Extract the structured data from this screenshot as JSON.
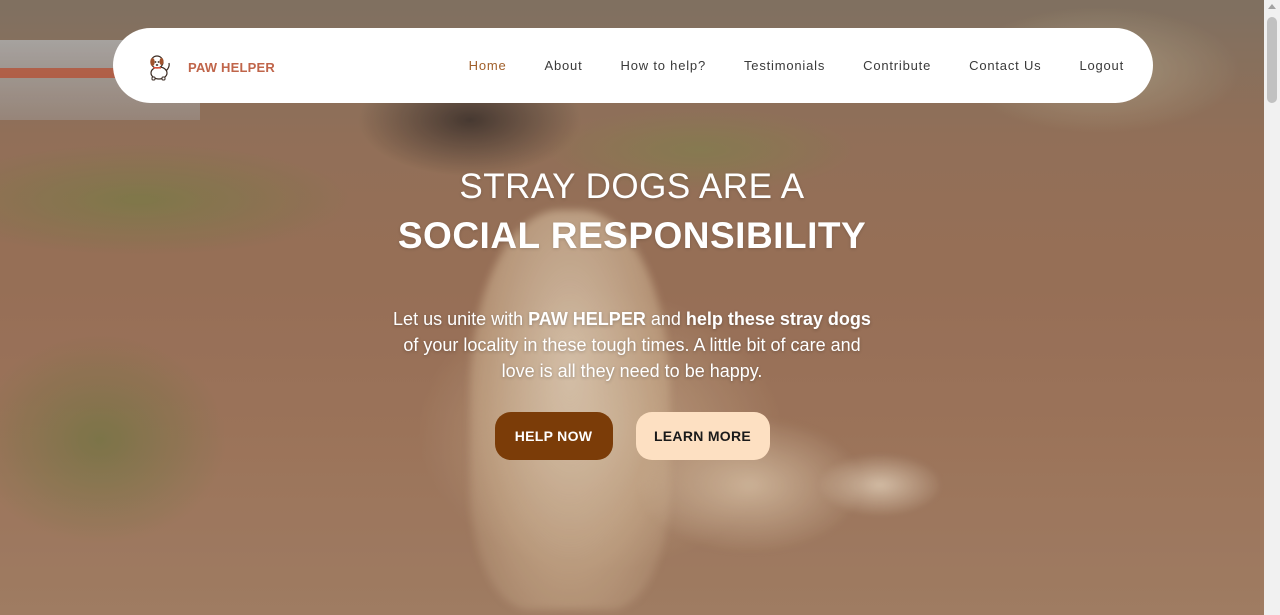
{
  "brand": {
    "name": "PAW HELPER",
    "logo_icon": "dog-logo-icon",
    "color": "#c0654a"
  },
  "nav": {
    "items": [
      {
        "label": "Home",
        "active": true
      },
      {
        "label": "About"
      },
      {
        "label": "How to help?"
      },
      {
        "label": "Testimonials"
      },
      {
        "label": "Contribute"
      },
      {
        "label": "Contact Us"
      },
      {
        "label": "Logout"
      }
    ],
    "active_color": "#a05f2a"
  },
  "hero": {
    "headline_line1": "STRAY DOGS ARE A",
    "headline_line2": "SOCIAL RESPONSIBILITY",
    "tagline_parts": [
      {
        "text": "Let us unite with ",
        "bold": false
      },
      {
        "text": "PAW HELPER",
        "bold": true
      },
      {
        "text": " and ",
        "bold": false
      },
      {
        "text": "help these stray dogs",
        "bold": true
      },
      {
        "text": " of your locality in these tough times. A little bit of care and love is all they need to be happy.",
        "bold": false
      }
    ]
  },
  "buttons": {
    "help_now": "HELP NOW",
    "learn_more": "LEARN MORE",
    "help_color": "#7b3c08",
    "learn_color": "#fde0c2"
  }
}
